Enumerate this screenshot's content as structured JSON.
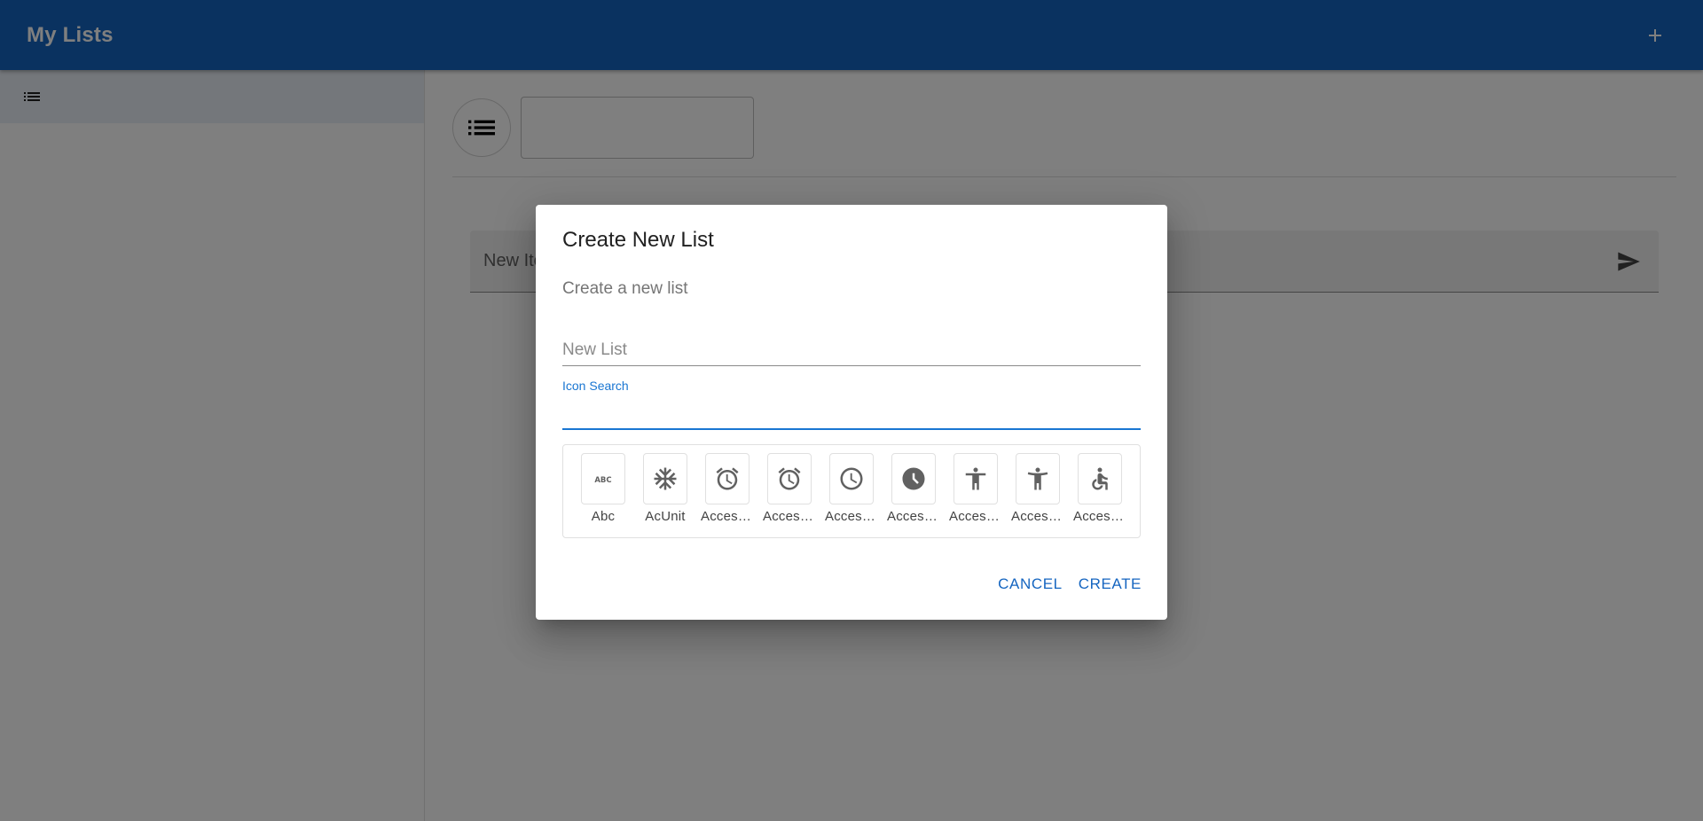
{
  "appbar": {
    "title": "My Lists",
    "add_icon": "plus-icon"
  },
  "sidebar": {
    "items": [
      {
        "icon": "list-icon",
        "label": ""
      }
    ]
  },
  "main": {
    "list_icon": "list-icon",
    "list_name": "",
    "new_item_placeholder": "New Item",
    "send_icon": "send-icon"
  },
  "dialog": {
    "title": "Create New List",
    "subtitle": "Create a new list",
    "name_placeholder": "New List",
    "name_value": "",
    "search_label": "Icon Search",
    "search_value": "",
    "icons": [
      {
        "label": "Abc",
        "icon": "abc-icon"
      },
      {
        "label": "AcUnit",
        "icon": "ac-unit-icon"
      },
      {
        "label": "AccessAlarm",
        "icon": "access-alarm-icon"
      },
      {
        "label": "AccessAlarms",
        "icon": "access-alarms-icon"
      },
      {
        "label": "AccessTime",
        "icon": "access-time-icon"
      },
      {
        "label": "AccessTimeFilled",
        "icon": "access-time-filled-icon"
      },
      {
        "label": "Accessibility",
        "icon": "accessibility-icon"
      },
      {
        "label": "AccessibilityNew",
        "icon": "accessibility-new-icon"
      },
      {
        "label": "Accessible",
        "icon": "accessible-icon"
      }
    ],
    "cancel_label": "CANCEL",
    "create_label": "CREATE"
  },
  "colors": {
    "primary": "#1565c0",
    "accent": "#1976d2",
    "icon_gray": "#616161"
  }
}
